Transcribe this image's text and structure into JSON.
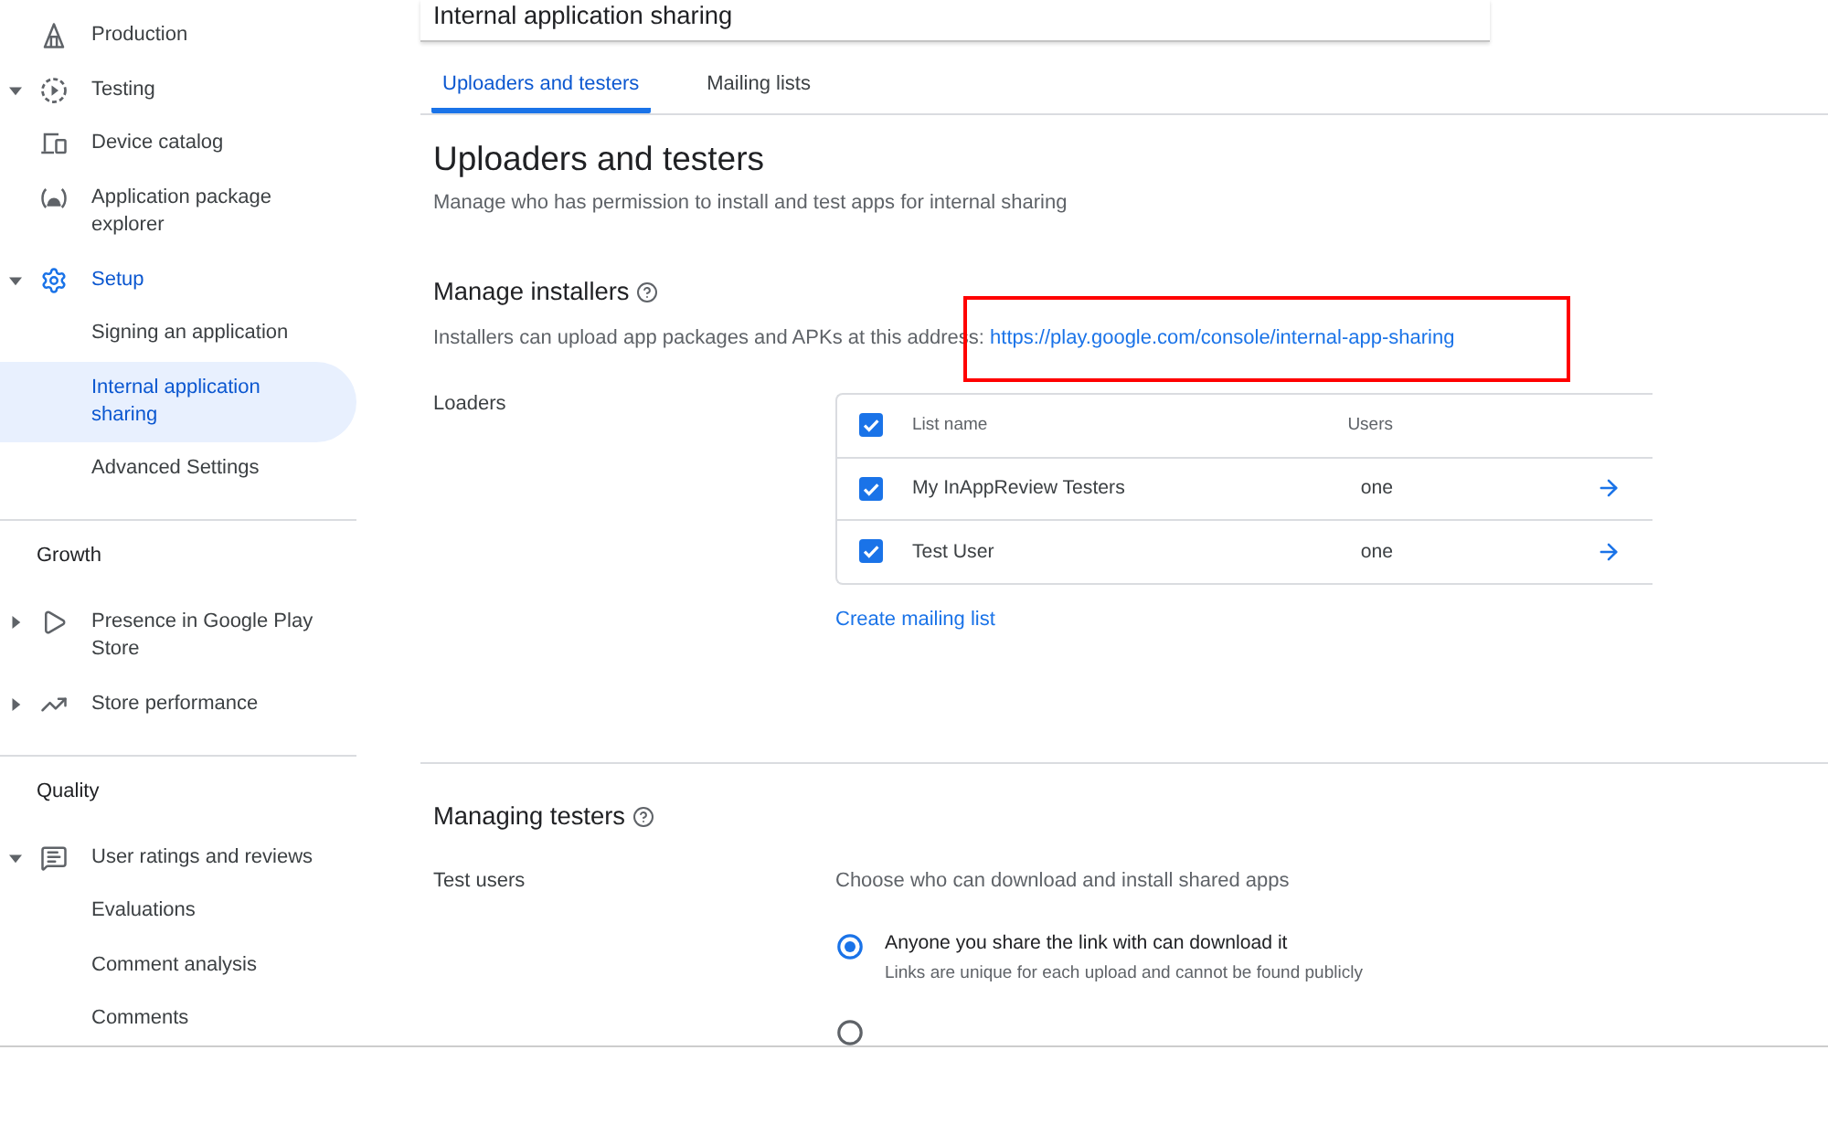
{
  "header": {
    "title": "Internal application sharing"
  },
  "sidebar": {
    "sections": [
      {
        "items": [
          {
            "kind": "page",
            "label": "Production",
            "selected": false
          },
          {
            "kind": "group",
            "label": "Testing",
            "expanded": true,
            "selected": false
          },
          {
            "kind": "page",
            "label": "Device catalog",
            "selected": false
          },
          {
            "kind": "page",
            "label": "Application package explorer",
            "selected": false
          },
          {
            "kind": "group",
            "label": "Setup",
            "expanded": true,
            "selected": false,
            "children": [
              {
                "label": "Signing an application",
                "selected": false
              },
              {
                "label": "Internal application sharing",
                "selected": true
              },
              {
                "label": "Advanced Settings",
                "selected": false
              }
            ]
          }
        ]
      },
      {
        "title": "Growth",
        "items": [
          {
            "kind": "group",
            "label": "Presence in Google Play Store",
            "expanded": false,
            "selected": false
          },
          {
            "kind": "group",
            "label": "Store performance",
            "expanded": false,
            "selected": false
          }
        ]
      },
      {
        "title": "Quality",
        "items": [
          {
            "kind": "group",
            "label": "User ratings and reviews",
            "expanded": true,
            "selected": false,
            "children": [
              {
                "label": "Evaluations",
                "selected": false
              },
              {
                "label": "Comment analysis",
                "selected": false
              },
              {
                "label": "Comments",
                "selected": false
              }
            ]
          }
        ]
      }
    ]
  },
  "tabs": [
    {
      "label": "Uploaders and testers",
      "selected": true
    },
    {
      "label": "Mailing lists",
      "selected": false
    }
  ],
  "page": {
    "title": "Uploaders and testers",
    "subtitle": "Manage who has permission to install and test apps for internal sharing"
  },
  "installers": {
    "title": "Manage installers",
    "description": "Installers can upload app packages and APKs at this address:",
    "link": "https://play.google.com/console/internal-app-sharing",
    "link_highlighted": true,
    "field_label": "Loaders",
    "table": {
      "columns": [
        "List name",
        "Users"
      ],
      "header_checked": true,
      "rows": [
        {
          "name": "My InAppReview Testers",
          "users": "one",
          "checked": true
        },
        {
          "name": "Test User",
          "users": "one",
          "checked": true
        }
      ]
    },
    "create_link": "Create mailing list"
  },
  "testers": {
    "title": "Managing testers",
    "field_label": "Test users",
    "prompt": "Choose who can download and install shared apps",
    "options": [
      {
        "label": "Anyone you share the link with can download it",
        "hint": "Links are unique for each upload and cannot be found publicly",
        "selected": true
      },
      {
        "selected": false
      }
    ]
  }
}
